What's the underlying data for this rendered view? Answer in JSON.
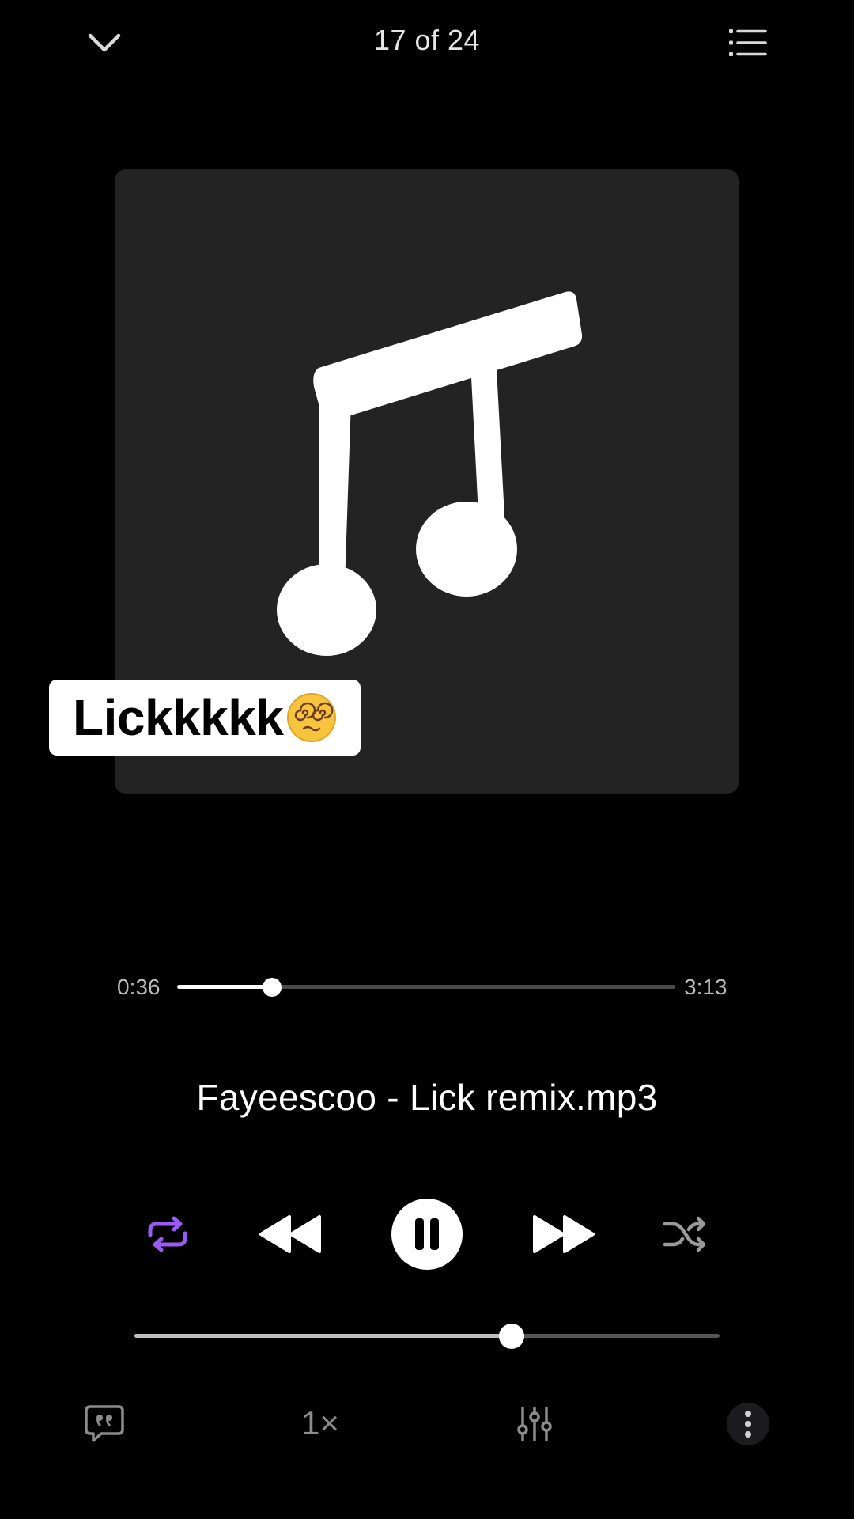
{
  "header": {
    "counter": "17 of 24",
    "collapse_icon": "chevron-down-icon",
    "queue_icon": "list-icon"
  },
  "artwork": {
    "icon": "music-note-icon",
    "background": "#232323"
  },
  "caption": {
    "text": "Lickkkkk",
    "emoji": "dizzy-face-emoji"
  },
  "progress": {
    "elapsed": "0:36",
    "duration": "3:13",
    "fraction": 0.19
  },
  "track": {
    "title": "Fayeescoo - Lick remix.mp3"
  },
  "controls": {
    "repeat_icon": "repeat-icon",
    "repeat_color": "#9b59f5",
    "previous_icon": "rewind-icon",
    "play_state_icon": "pause-icon",
    "next_icon": "fast-forward-icon",
    "shuffle_icon": "shuffle-icon"
  },
  "volume": {
    "fraction": 0.645
  },
  "bottom_bar": {
    "lyrics_icon": "quote-bubble-icon",
    "speed_label": "1×",
    "equalizer_icon": "equalizer-icon",
    "more_icon": "more-vertical-icon"
  }
}
